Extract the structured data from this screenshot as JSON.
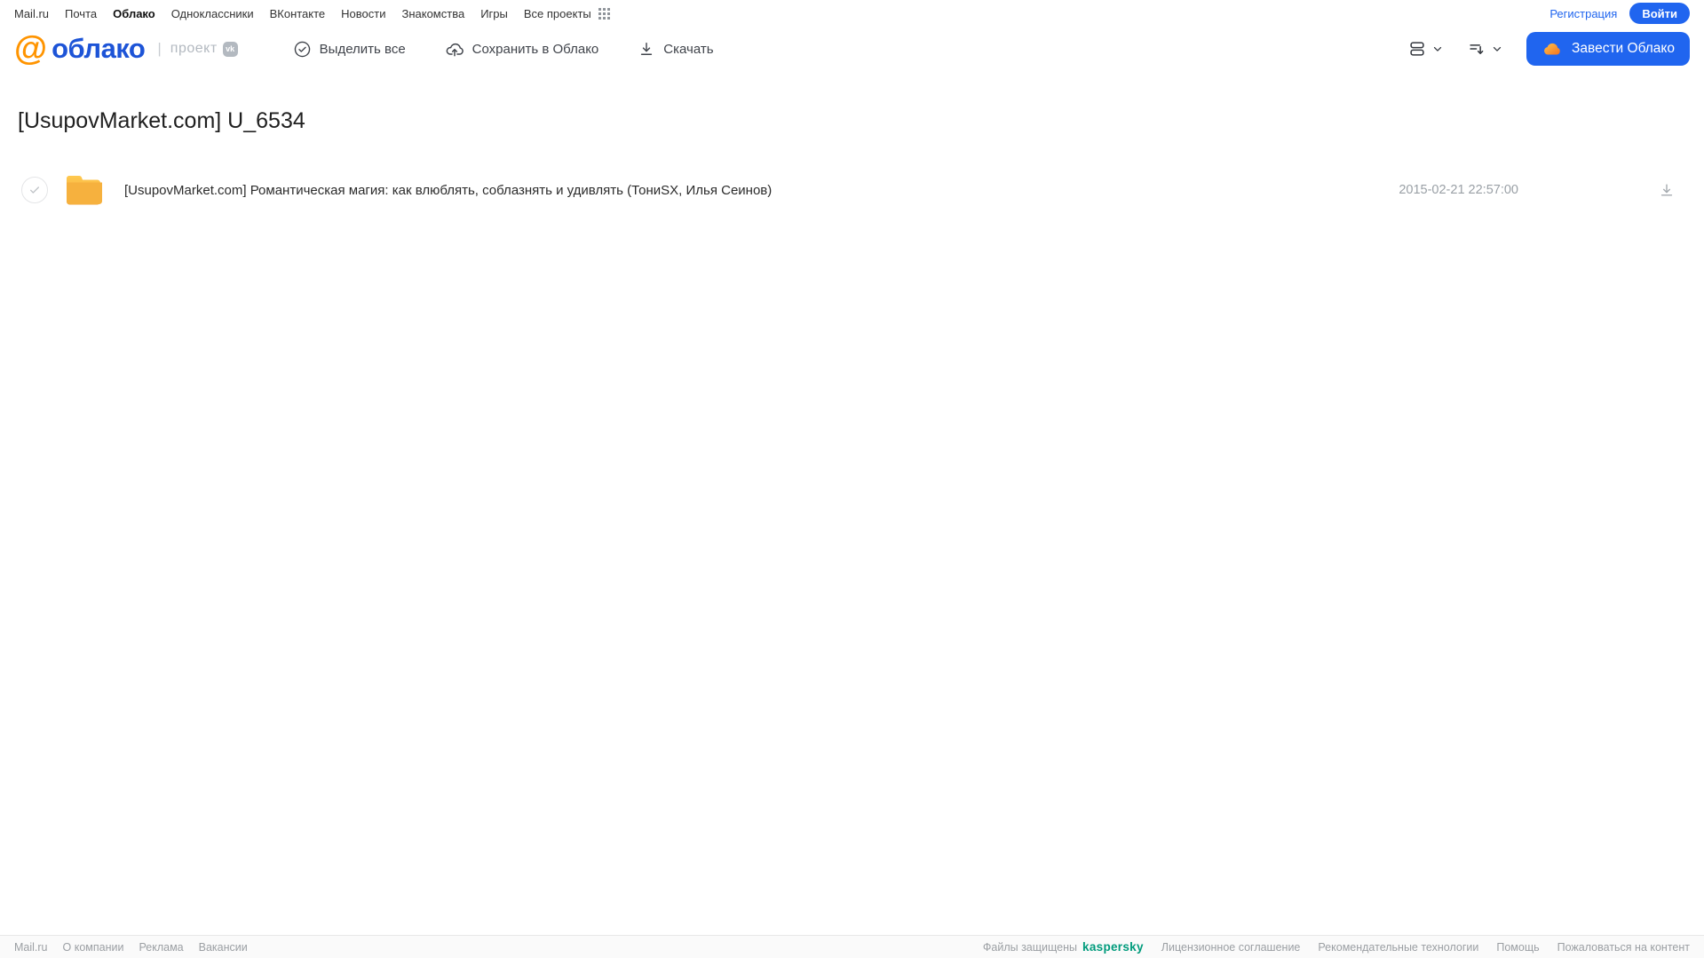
{
  "top_nav": {
    "links": [
      "Mail.ru",
      "Почта",
      "Облако",
      "Одноклассники",
      "ВКонтакте",
      "Новости",
      "Знакомства",
      "Игры",
      "Все проекты"
    ],
    "active_link": "Облако",
    "registration_label": "Регистрация",
    "login_label": "Войти"
  },
  "header": {
    "logo_at": "@",
    "logo_text": "облако",
    "project_label": "проект",
    "project_badge": "vk",
    "toolbar": [
      {
        "label": "Выделить все",
        "icon": "check-circle-icon"
      },
      {
        "label": "Сохранить в Облако",
        "icon": "cloud-upload-icon"
      },
      {
        "label": "Скачать",
        "icon": "download-icon"
      }
    ],
    "view_controls": [
      {
        "icon": "list-view-icon"
      },
      {
        "icon": "sort-icon"
      }
    ],
    "create_cloud_label": "Завести Облако"
  },
  "main": {
    "title": "[UsupovMarket.com] U_6534",
    "files": [
      {
        "type": "folder",
        "name": "[UsupovMarket.com] Романтическая магия: как влюблять, соблазнять и удивлять (ТониSX, Илья Сеинов)",
        "date": "2015-02-21 22:57:00"
      }
    ]
  },
  "footer": {
    "left_links": [
      "Mail.ru",
      "О компании",
      "Реклама",
      "Вакансии"
    ],
    "protected_text": "Файлы защищены",
    "kaspersky_label": "kaspersky",
    "right_links": [
      "Лицензионное соглашение",
      "Рекомендательные технологии",
      "Помощь",
      "Пожаловаться на контент"
    ]
  },
  "colors": {
    "accent_blue": "#2065ef",
    "logo_blue": "#1d54d7",
    "logo_orange": "#ff9400",
    "folder_top": "#ffc94f",
    "folder_bottom": "#f0a437",
    "kaspersky_green": "#009b7c",
    "muted_gray": "#9aa0a6"
  }
}
